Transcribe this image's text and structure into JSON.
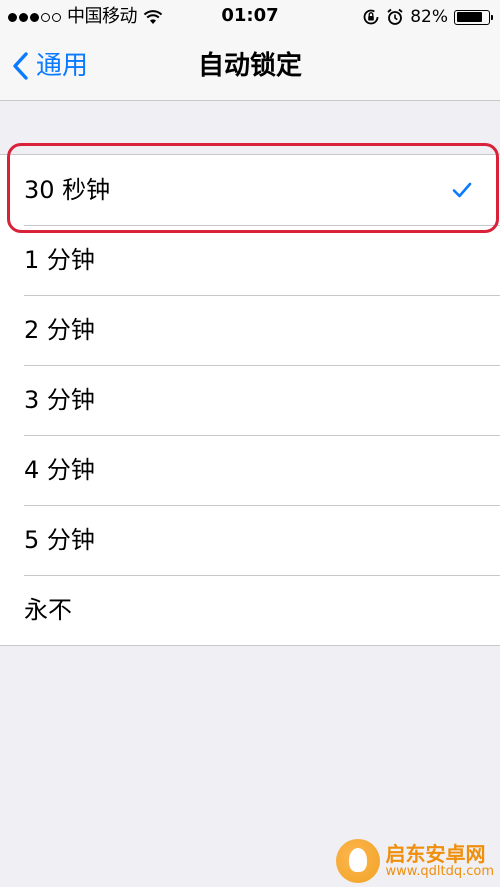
{
  "status_bar": {
    "carrier": "中国移动",
    "time": "01:07",
    "battery_percent": "82%",
    "battery_level": 0.82
  },
  "nav": {
    "back_label": "通用",
    "title": "自动锁定"
  },
  "options": [
    {
      "label": "30 秒钟",
      "selected": true
    },
    {
      "label": "1 分钟",
      "selected": false
    },
    {
      "label": "2 分钟",
      "selected": false
    },
    {
      "label": "3 分钟",
      "selected": false
    },
    {
      "label": "4 分钟",
      "selected": false
    },
    {
      "label": "5 分钟",
      "selected": false
    },
    {
      "label": "永不",
      "selected": false
    }
  ],
  "colors": {
    "accent": "#0a7aff",
    "annotation": "#d9223a",
    "background": "#efeff4"
  },
  "watermark": {
    "name": "启东安卓网",
    "url": "www.qdltdq.com"
  }
}
